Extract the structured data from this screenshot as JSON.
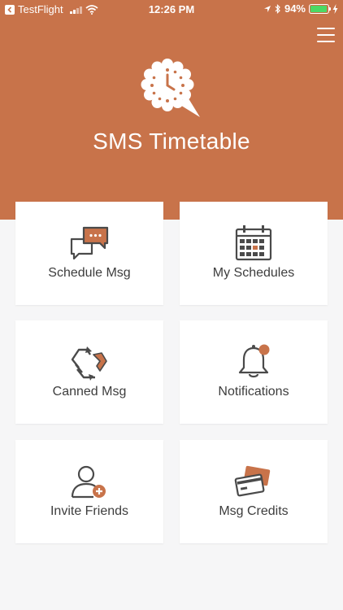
{
  "status_bar": {
    "back_app": "TestFlight",
    "time": "12:26 PM",
    "battery": "94%",
    "battery_level": 0.94
  },
  "header": {
    "title": "SMS Timetable",
    "menu_icon": "hamburger-menu-icon",
    "logo_icon": "clock-chat-bubble-icon"
  },
  "colors": {
    "brand": "#c8734a",
    "icon_dark": "#4a4a4a",
    "label": "#3d3d3d",
    "background": "#f6f6f7"
  },
  "tiles": [
    {
      "label": "Schedule Msg",
      "icon": "chat-bubbles-icon"
    },
    {
      "label": "My Schedules",
      "icon": "calendar-icon"
    },
    {
      "label": "Canned Msg",
      "icon": "recycle-arrows-icon"
    },
    {
      "label": "Notifications",
      "icon": "bell-icon"
    },
    {
      "label": "Invite Friends",
      "icon": "add-user-icon"
    },
    {
      "label": "Msg Credits",
      "icon": "credit-cards-icon"
    }
  ]
}
